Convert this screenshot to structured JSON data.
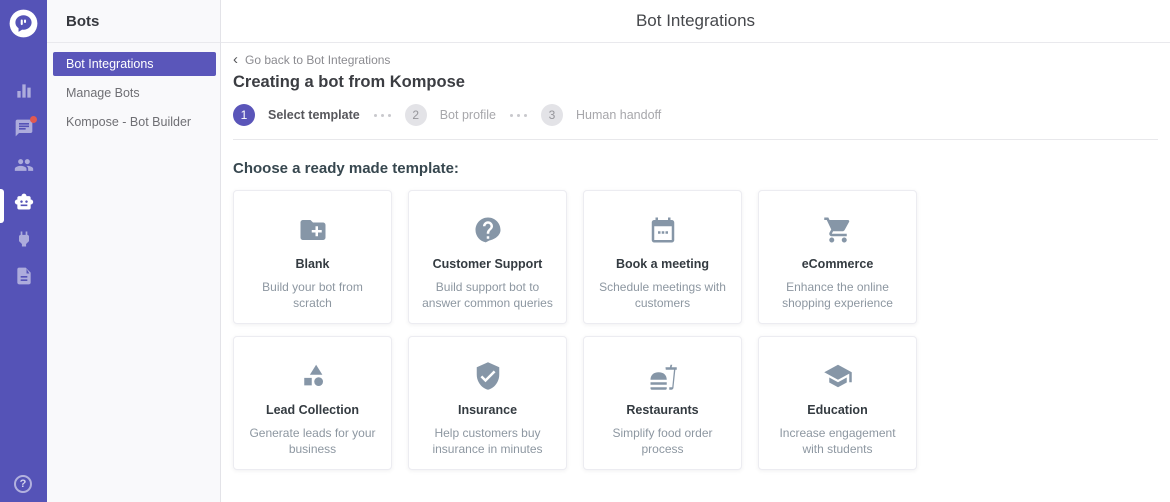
{
  "colors": {
    "rail_purple": "#5553b7",
    "active_item_purple": "#5a56ba",
    "step_active_purple": "#5a55b9",
    "notification_red": "#e25950",
    "card_icon_gray": "#8696a7"
  },
  "rail": {
    "logo_icon": "kommunicate-logo-icon",
    "items": [
      {
        "icon": "analytics-icon",
        "active": false,
        "badge": false
      },
      {
        "icon": "conversations-icon",
        "active": false,
        "badge": true
      },
      {
        "icon": "contacts-icon",
        "active": false,
        "badge": false
      },
      {
        "icon": "bot-icon",
        "active": true,
        "badge": false
      },
      {
        "icon": "integrations-icon",
        "active": false,
        "badge": false
      },
      {
        "icon": "helpcenter-icon",
        "active": false,
        "badge": false
      }
    ],
    "help_label": "?"
  },
  "sidebar": {
    "title": "Bots",
    "items": [
      {
        "label": "Bot Integrations",
        "active": true
      },
      {
        "label": "Manage Bots",
        "active": false
      },
      {
        "label": "Kompose - Bot Builder",
        "active": false
      }
    ]
  },
  "header": {
    "title": "Bot Integrations"
  },
  "main": {
    "back_chevron": "‹",
    "back_link": "Go back to Bot Integrations",
    "page_title": "Creating a bot from Kompose",
    "steps": [
      {
        "number": "1",
        "label": "Select template",
        "active": true
      },
      {
        "number": "2",
        "label": "Bot profile",
        "active": false
      },
      {
        "number": "3",
        "label": "Human handoff",
        "active": false
      }
    ],
    "section_title": "Choose a ready made template:",
    "templates": [
      {
        "title": "Blank",
        "description": "Build your bot from scratch",
        "icon": "folder-plus-icon"
      },
      {
        "title": "Customer Support",
        "description": "Build support bot to answer common queries",
        "icon": "help-circle-icon"
      },
      {
        "title": "Book a meeting",
        "description": "Schedule meetings with customers",
        "icon": "calendar-icon"
      },
      {
        "title": "eCommerce",
        "description": "Enhance the online shopping experience",
        "icon": "shopping-cart-icon"
      },
      {
        "title": "Lead Collection",
        "description": "Generate leads for your business",
        "icon": "shapes-icon"
      },
      {
        "title": "Insurance",
        "description": "Help customers buy insurance in minutes",
        "icon": "shield-check-icon"
      },
      {
        "title": "Restaurants",
        "description": "Simplify food order process",
        "icon": "fastfood-icon"
      },
      {
        "title": "Education",
        "description": "Increase engagement with students",
        "icon": "graduation-cap-icon"
      }
    ]
  }
}
